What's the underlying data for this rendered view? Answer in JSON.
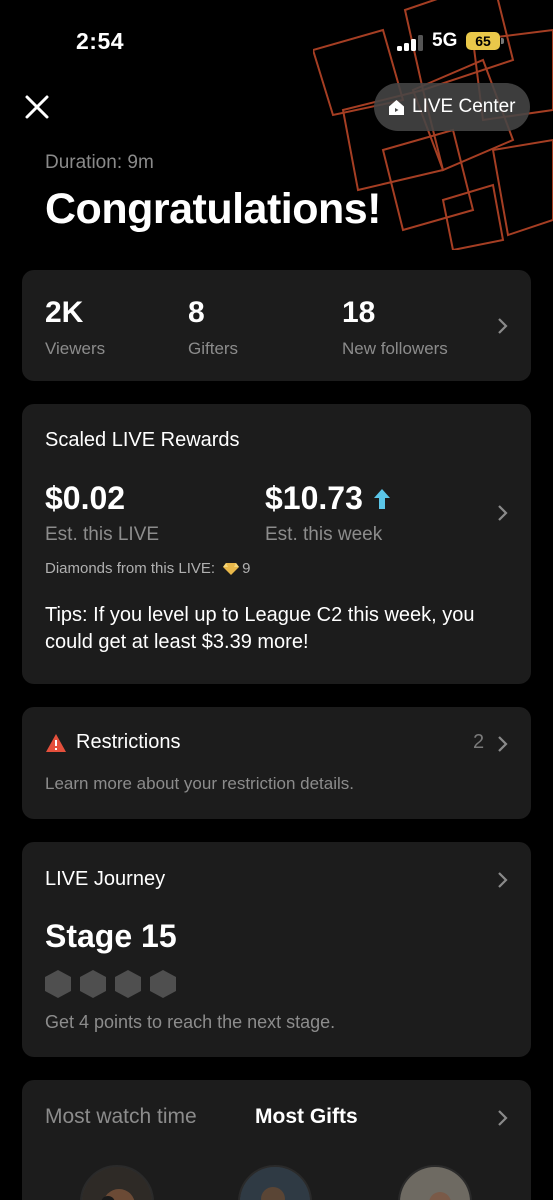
{
  "status_bar": {
    "time": "2:54",
    "network": "5G",
    "battery": "65"
  },
  "header": {
    "live_center_label": "LIVE Center"
  },
  "summary": {
    "duration": "Duration: 9m",
    "headline": "Congratulations!"
  },
  "stats": [
    {
      "value": "2K",
      "label": "Viewers"
    },
    {
      "value": "8",
      "label": "Gifters"
    },
    {
      "value": "18",
      "label": "New followers"
    }
  ],
  "rewards": {
    "title": "Scaled LIVE Rewards",
    "this_live_value": "$0.02",
    "this_live_label": "Est. this LIVE",
    "this_week_value": "$10.73",
    "this_week_label": "Est. this week",
    "diamonds_label": "Diamonds from this LIVE:",
    "diamonds_count": "9",
    "tips": "Tips: If you level up to League C2 this week, you could get at least $3.39 more!"
  },
  "restrictions": {
    "title": "Restrictions",
    "count": "2",
    "description": "Learn more about your restriction details."
  },
  "journey": {
    "title": "LIVE Journey",
    "stage": "Stage 15",
    "points_needed": 4,
    "description": "Get 4 points to reach the next stage."
  },
  "ranking": {
    "tabs": [
      "Most watch time",
      "Most Gifts"
    ],
    "active_tab": "Most Gifts"
  },
  "colors": {
    "background": "#000000",
    "card": "#1c1c1c",
    "accent_blue": "#5bc6e8",
    "warning_red": "#e5503c",
    "battery": "#e9c84a",
    "decoration": "#c2492a"
  }
}
